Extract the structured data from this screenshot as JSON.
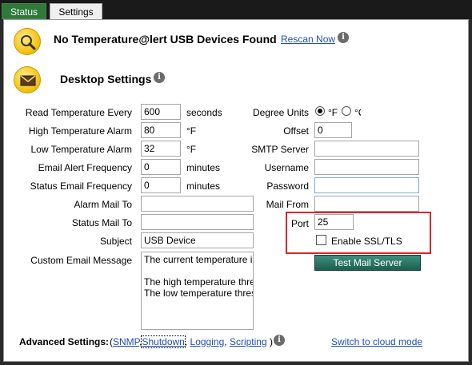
{
  "tabs": [
    {
      "label": "Status"
    },
    {
      "label": "Settings"
    }
  ],
  "header": {
    "no_devices_text": "No Temperature@lert USB Devices Found",
    "rescan_link": "Rescan Now",
    "desktop_settings_title": "Desktop Settings"
  },
  "left_form": {
    "read_temp": {
      "label": "Read Temperature Every",
      "value": "600",
      "unit": "seconds"
    },
    "high_alarm": {
      "label": "High Temperature Alarm",
      "value": "80",
      "unit": "°F"
    },
    "low_alarm": {
      "label": "Low Temperature Alarm",
      "value": "32",
      "unit": "°F"
    },
    "email_freq": {
      "label": "Email Alert Frequency",
      "value": "0",
      "unit": "minutes"
    },
    "status_freq": {
      "label": "Status Email Frequency",
      "value": "0",
      "unit": "minutes"
    },
    "alarm_mail_to": {
      "label": "Alarm Mail To",
      "value": ""
    },
    "status_mail_to": {
      "label": "Status Mail To",
      "value": ""
    },
    "subject": {
      "label": "Subject",
      "value": "USB Device"
    },
    "custom_message": {
      "label": "Custom Email Message",
      "value": "The current temperature i\n\nThe high temperature thre\nThe low temperature thres"
    }
  },
  "right_form": {
    "degree_units": {
      "label": "Degree Units",
      "option_f": "°F",
      "option_c": "°C",
      "selected": "°F"
    },
    "offset": {
      "label": "Offset",
      "value": "0"
    },
    "smtp_server": {
      "label": "SMTP Server",
      "value": ""
    },
    "username": {
      "label": "Username",
      "value": ""
    },
    "password": {
      "label": "Password",
      "value": ""
    },
    "mail_from": {
      "label": "Mail From",
      "value": ""
    },
    "port": {
      "label": "Port",
      "value": "25"
    },
    "ssl": {
      "label": "Enable SSL/TLS",
      "checked": false
    },
    "test_button": "Test Mail Server"
  },
  "advanced": {
    "label": "Advanced Settings:",
    "open_paren": "(",
    "snmp": "SNMP",
    "shutdown": "Shutdown",
    "logging": "Logging",
    "scripting": "Scripting",
    "comma": ",",
    "close_paren": ")",
    "cloud_link": "Switch to cloud mode"
  },
  "colors": {
    "tab_active": "#2f7a3a",
    "link": "#1f4fb8",
    "highlight": "#d8272d",
    "button": "#2a7566"
  },
  "icons": {
    "search": "magnifier-icon",
    "mail": "envelope-icon",
    "info": "info-icon"
  }
}
